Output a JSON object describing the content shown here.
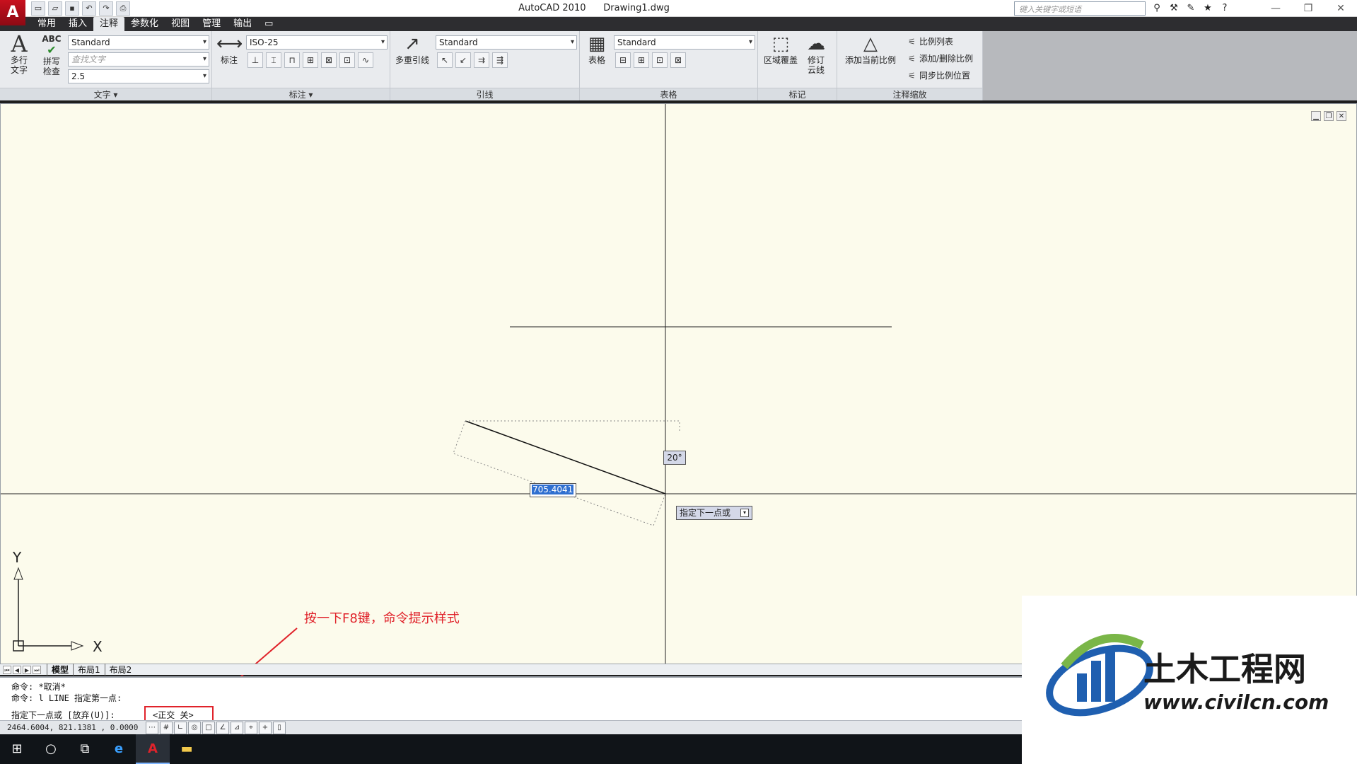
{
  "app": {
    "logo_letter": "A",
    "title": "AutoCAD 2010      Drawing1.dwg",
    "search_placeholder": "键入关键字或短语"
  },
  "tabs": [
    "常用",
    "插入",
    "注释",
    "参数化",
    "视图",
    "管理",
    "输出"
  ],
  "active_tab": "注释",
  "ribbon": {
    "text_panel": {
      "title": "文字 ▾",
      "mtext_label_1": "多行",
      "mtext_label_2": "文字",
      "spell_icon_text": "ABC",
      "spell_label_1": "拼写",
      "spell_label_2": "检查",
      "style_value": "Standard",
      "find_placeholder": "查找文字",
      "height_value": "2.5"
    },
    "dim_panel": {
      "title": "标注 ▾",
      "dim_label": "标注",
      "style_value": "ISO-25"
    },
    "leader_panel": {
      "title": "引线",
      "mleader_label": "多重引线",
      "style_value": "Standard"
    },
    "table_panel": {
      "title": "表格",
      "table_label": "表格",
      "style_value": "Standard"
    },
    "markup_panel": {
      "title": "标记",
      "wipeout_label": "区域覆盖",
      "revcloud_label_1": "修订",
      "revcloud_label_2": "云线"
    },
    "scale_panel": {
      "title": "注释缩放",
      "add_current_label": "添加当前比例",
      "scale_list": "比例列表",
      "add_delete": "添加/删除比例",
      "sync": "同步比例位置"
    }
  },
  "drawing": {
    "length_input": "705.4041",
    "angle_tooltip": "20°",
    "prompt_tooltip": "指定下一点或",
    "ucs_y": "Y",
    "ucs_x": "X"
  },
  "layout_tabs": [
    "模型",
    "布局1",
    "布局2"
  ],
  "command_line": {
    "line1": "命令: *取消*",
    "line2": "命令: l LINE 指定第一点:",
    "line3": "指定下一点或 [放弃(U)]:",
    "prompt_box": "<正交 关>"
  },
  "status": {
    "coords": "2464.6004, 821.1381 , 0.0000"
  },
  "annotation": "按一下F8键，命令提示样式",
  "watermark": {
    "brand": "土木工程网",
    "url": "www.civilcn.com"
  },
  "colors": {
    "canvas": "#fcfbec",
    "annotation_red": "#e0232b",
    "watermark_blue": "#1f5fb0",
    "watermark_green": "#7ab648"
  }
}
